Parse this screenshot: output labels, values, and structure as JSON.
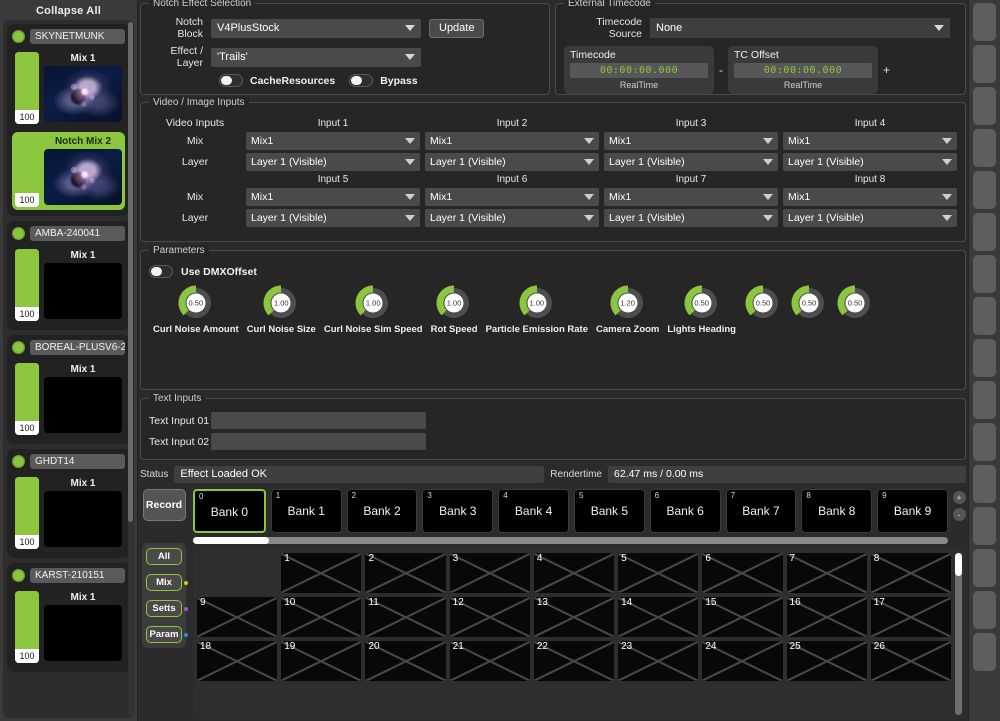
{
  "sidebar": {
    "collapse_all_label": "Collapse All",
    "fixtures": [
      {
        "name": "SKYNETMUNK",
        "selected": false,
        "mixes": [
          {
            "label": "Mix 1",
            "level": "100",
            "selected": false,
            "art": true
          },
          {
            "label": "Notch Mix 2",
            "level": "100",
            "selected": true,
            "art": true
          }
        ]
      },
      {
        "name": "AMBA-240041",
        "selected": false,
        "mixes": [
          {
            "label": "Mix 1",
            "level": "100",
            "selected": false,
            "art": false
          }
        ]
      },
      {
        "name": "BOREAL-PLUSV6-2",
        "selected": false,
        "mixes": [
          {
            "label": "Mix 1",
            "level": "100",
            "selected": false,
            "art": false
          }
        ]
      },
      {
        "name": "GHDT14",
        "selected": false,
        "mixes": [
          {
            "label": "Mix 1",
            "level": "100",
            "selected": false,
            "art": false
          }
        ]
      },
      {
        "name": "KARST-210151",
        "selected": false,
        "mixes": [
          {
            "label": "Mix 1",
            "level": "100",
            "selected": false,
            "art": false
          }
        ]
      }
    ]
  },
  "notch_effect_selection": {
    "title": "Notch Effect Selection",
    "notch_block_label": "Notch Block",
    "notch_block_value": "V4PlusStock",
    "update_label": "Update",
    "effect_layer_label": "Effect / Layer",
    "effect_layer_value": "'Trails'",
    "cache_resources_label": "CacheResources",
    "cache_resources_on": false,
    "bypass_label": "Bypass",
    "bypass_on": false
  },
  "external_timecode": {
    "title": "External Timecode",
    "source_label": "Timecode Source",
    "source_value": "None",
    "timecode_label": "Timecode",
    "timecode_value": "00:00:00.000",
    "timecode_mode": "RealTime",
    "minus_label": "-",
    "plus_label": "+",
    "tc_offset_label": "TC Offset",
    "tc_offset_value": "00:00:00.000",
    "tc_offset_mode": "RealTime"
  },
  "video_image_inputs": {
    "title": "Video / Image Inputs",
    "video_inputs_label": "Video Inputs",
    "mix_label": "Mix",
    "layer_label": "Layer",
    "rows": [
      {
        "headers": [
          "Input 1",
          "Input 2",
          "Input 3",
          "Input 4"
        ],
        "mix": [
          "Mix1",
          "Mix1",
          "Mix1",
          "Mix1"
        ],
        "layer": [
          "Layer 1 (Visible)",
          "Layer 1 (Visible)",
          "Layer 1 (Visible)",
          "Layer 1 (Visible)"
        ]
      },
      {
        "headers": [
          "Input 5",
          "Input 6",
          "Input 7",
          "Input 8"
        ],
        "mix": [
          "Mix1",
          "Mix1",
          "Mix1",
          "Mix1"
        ],
        "layer": [
          "Layer 1 (Visible)",
          "Layer 1 (Visible)",
          "Layer 1 (Visible)",
          "Layer 1 (Visible)"
        ]
      }
    ]
  },
  "parameters": {
    "title": "Parameters",
    "use_dmx_offset_label": "Use DMXOffset",
    "use_dmx_offset_on": false,
    "knobs": [
      {
        "label": "Curl Noise Amount",
        "value": "0.50",
        "pct": 0.5
      },
      {
        "label": "Curl Noise Size",
        "value": "1.00",
        "pct": 0.5
      },
      {
        "label": "Curl Noise Sim Speed",
        "value": "1.00",
        "pct": 0.5
      },
      {
        "label": "Rot Speed",
        "value": "1.00",
        "pct": 0.5
      },
      {
        "label": "Particle Emission Rate",
        "value": "1.00",
        "pct": 0.5
      },
      {
        "label": "Camera Zoom",
        "value": "1.20",
        "pct": 0.5
      },
      {
        "label": "Lights Heading",
        "value": "0.50",
        "pct": 0.5
      },
      {
        "label": "",
        "value": "0.50",
        "pct": 0.5
      },
      {
        "label": "",
        "value": "0.50",
        "pct": 0.5
      },
      {
        "label": "",
        "value": "0.50",
        "pct": 0.5
      }
    ]
  },
  "text_inputs": {
    "title": "Text Inputs",
    "fields": [
      {
        "label": "Text Input 01",
        "value": "",
        "placeholder": ""
      },
      {
        "label": "Text Input 02",
        "value": "",
        "placeholder": ""
      }
    ]
  },
  "status_bar": {
    "status_label": "Status",
    "status_value": "Effect Loaded OK",
    "rendertime_label": "Rendertime",
    "rendertime_value": "62.47 ms / 0.00 ms"
  },
  "banks": {
    "record_label": "Record",
    "filters": [
      {
        "label": "All",
        "dot": ""
      },
      {
        "label": "Mix",
        "dot": "#e0c020"
      },
      {
        "label": "Setts",
        "dot": "#b050c8"
      },
      {
        "label": "Param",
        "dot": "#4080e0"
      }
    ],
    "items": [
      {
        "index": "0",
        "name": "Bank 0",
        "active": true
      },
      {
        "index": "1",
        "name": "Bank 1",
        "active": false
      },
      {
        "index": "2",
        "name": "Bank 2",
        "active": false
      },
      {
        "index": "3",
        "name": "Bank 3",
        "active": false
      },
      {
        "index": "4",
        "name": "Bank 4",
        "active": false
      },
      {
        "index": "5",
        "name": "Bank 5",
        "active": false
      },
      {
        "index": "6",
        "name": "Bank 6",
        "active": false
      },
      {
        "index": "7",
        "name": "Bank 7",
        "active": false
      },
      {
        "index": "8",
        "name": "Bank 8",
        "active": false
      },
      {
        "index": "9",
        "name": "Bank 9",
        "active": false
      }
    ],
    "zoom_in_label": "+",
    "zoom_out_label": "-"
  },
  "slots": {
    "rows": [
      [
        "",
        "1",
        "2",
        "3",
        "4",
        "5",
        "6",
        "7",
        "8"
      ],
      [
        "9",
        "10",
        "11",
        "12",
        "13",
        "14",
        "15",
        "16",
        "17"
      ],
      [
        "18",
        "19",
        "20",
        "21",
        "22",
        "23",
        "24",
        "25",
        "26"
      ]
    ]
  },
  "colors": {
    "accent_green": "#8cc63e",
    "panel_bg": "#2b2b2b",
    "group_bg": "#262626",
    "field_bg": "#4a4a4a",
    "sidebar_bg": "#3a3a3a"
  }
}
